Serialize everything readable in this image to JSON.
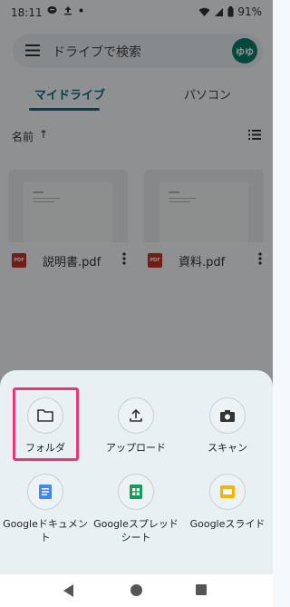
{
  "status_bar": {
    "time": "18:11",
    "battery": "91%",
    "icons": [
      "line-icon",
      "upload-icon",
      "dot-icon",
      "wifi-icon",
      "signal-icon",
      "battery-icon"
    ]
  },
  "search": {
    "placeholder": "ドライブで検索",
    "avatar_text": "ゆゆ"
  },
  "tabs": [
    {
      "label": "マイドライブ",
      "active": true
    },
    {
      "label": "パソコン",
      "active": false
    }
  ],
  "sort": {
    "label": "名前",
    "arrow": "↑"
  },
  "files": [
    {
      "name": "説明書.pdf",
      "type": "PDF"
    },
    {
      "name": "資料.pdf",
      "type": "PDF"
    }
  ],
  "sheet": {
    "actions": [
      {
        "label": "フォルダ",
        "icon": "folder-icon",
        "highlighted": true
      },
      {
        "label": "アップロード",
        "icon": "upload-icon"
      },
      {
        "label": "スキャン",
        "icon": "camera-icon"
      },
      {
        "label": "Googleドキュメント",
        "icon": "docs-icon",
        "color": "#4285f4"
      },
      {
        "label": "Googleスプレッドシート",
        "icon": "sheets-icon",
        "color": "#0f9d58"
      },
      {
        "label": "Googleスライド",
        "icon": "slides-icon",
        "color": "#f4b400"
      }
    ]
  },
  "colors": {
    "accent": "#0d6e84",
    "highlight": "#e9357a",
    "pdf": "#c5342a"
  }
}
